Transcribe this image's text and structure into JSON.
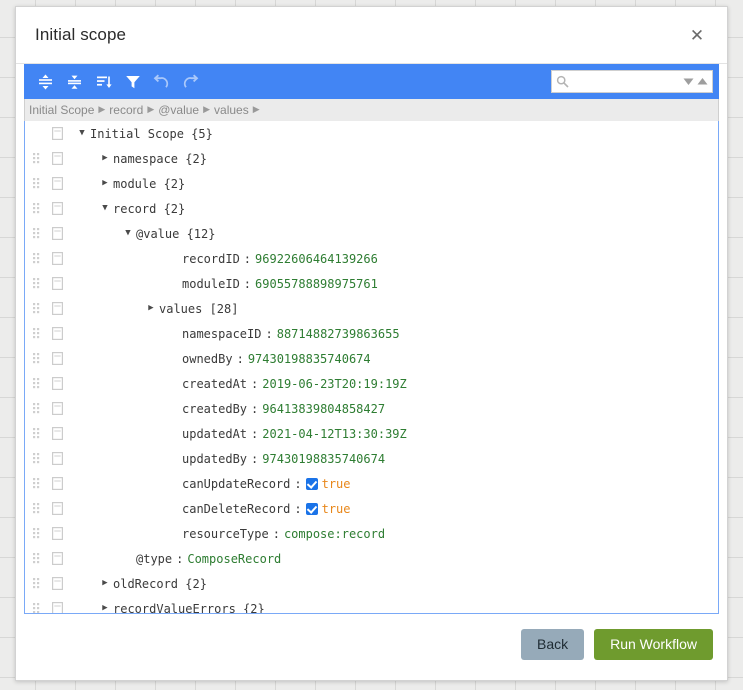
{
  "dialog": {
    "title": "Initial scope",
    "close_label": "✕"
  },
  "toolbar": {
    "buttons": [
      {
        "name": "expand-all-icon",
        "tooltip": "Expand all"
      },
      {
        "name": "collapse-all-icon",
        "tooltip": "Collapse all"
      },
      {
        "name": "sort-icon",
        "tooltip": "Sort"
      },
      {
        "name": "filter-icon",
        "tooltip": "Filter"
      },
      {
        "name": "undo-icon",
        "tooltip": "Undo"
      },
      {
        "name": "redo-icon",
        "tooltip": "Redo"
      }
    ],
    "search": {
      "value": "",
      "placeholder": ""
    },
    "accent_color": "#4285f4"
  },
  "breadcrumb": {
    "separator": "▶",
    "items": [
      "Initial Scope",
      "record",
      "@value",
      "values"
    ]
  },
  "tree": {
    "rows": [
      {
        "indent": 0,
        "twisty": "open",
        "key": "Initial Scope",
        "count": "{5}",
        "handle": false
      },
      {
        "indent": 1,
        "twisty": "closed",
        "key": "namespace",
        "count": "{2}",
        "handle": true
      },
      {
        "indent": 1,
        "twisty": "closed",
        "key": "module",
        "count": "{2}",
        "handle": true
      },
      {
        "indent": 1,
        "twisty": "open",
        "key": "record",
        "count": "{2}",
        "handle": true
      },
      {
        "indent": 2,
        "twisty": "open",
        "key": "@value",
        "count": "{12}",
        "handle": true
      },
      {
        "indent": 4,
        "twisty": "none",
        "key": "recordID",
        "value": "96922606464139266",
        "vtype": "string",
        "handle": true
      },
      {
        "indent": 4,
        "twisty": "none",
        "key": "moduleID",
        "value": "69055788898975761",
        "vtype": "string",
        "handle": true
      },
      {
        "indent": 3,
        "twisty": "closed",
        "key": "values",
        "count": "[28]",
        "handle": true
      },
      {
        "indent": 4,
        "twisty": "none",
        "key": "namespaceID",
        "value": "88714882739863655",
        "vtype": "string",
        "handle": true
      },
      {
        "indent": 4,
        "twisty": "none",
        "key": "ownedBy",
        "value": "97430198835740674",
        "vtype": "string",
        "handle": true
      },
      {
        "indent": 4,
        "twisty": "none",
        "key": "createdAt",
        "value": "2019-06-23T20:19:19Z",
        "vtype": "string",
        "handle": true
      },
      {
        "indent": 4,
        "twisty": "none",
        "key": "createdBy",
        "value": "96413839804858427",
        "vtype": "string",
        "handle": true
      },
      {
        "indent": 4,
        "twisty": "none",
        "key": "updatedAt",
        "value": "2021-04-12T13:30:39Z",
        "vtype": "string",
        "handle": true
      },
      {
        "indent": 4,
        "twisty": "none",
        "key": "updatedBy",
        "value": "97430198835740674",
        "vtype": "string",
        "handle": true
      },
      {
        "indent": 4,
        "twisty": "none",
        "key": "canUpdateRecord",
        "value": "true",
        "vtype": "boolean",
        "handle": true
      },
      {
        "indent": 4,
        "twisty": "none",
        "key": "canDeleteRecord",
        "value": "true",
        "vtype": "boolean",
        "handle": true
      },
      {
        "indent": 4,
        "twisty": "none",
        "key": "resourceType",
        "value": "compose:record",
        "vtype": "string",
        "handle": true
      },
      {
        "indent": 2,
        "twisty": "none",
        "key": "@type",
        "value": "ComposeRecord",
        "vtype": "string",
        "handle": true
      },
      {
        "indent": 1,
        "twisty": "closed",
        "key": "oldRecord",
        "count": "{2}",
        "handle": true
      },
      {
        "indent": 1,
        "twisty": "closed",
        "key": "recordValueErrors",
        "count": "{2}",
        "handle": true
      }
    ]
  },
  "footer": {
    "back_label": "Back",
    "run_label": "Run Workflow",
    "back_color": "#96aab9",
    "run_color": "#6f9b2e"
  }
}
